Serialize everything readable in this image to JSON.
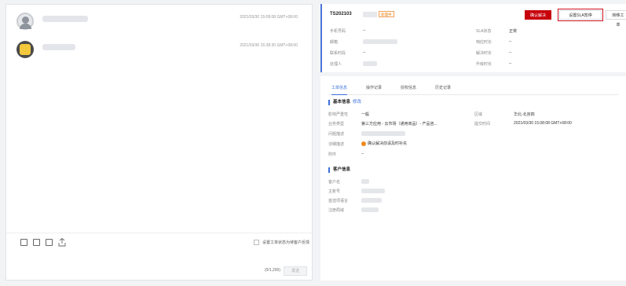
{
  "conversations": [
    {
      "time": "2021/03/30 15:08:08 GMT+08:00",
      "avatar": "user-avatar-icon"
    },
    {
      "time": "2021/03/30 15:38:30 GMT+08:00",
      "avatar": "bot-avatar-icon"
    }
  ],
  "composer": {
    "checkbox_label": "设置工单状态为待客户反馈",
    "counter": "(0/1,200)",
    "send_label": "发送"
  },
  "ticket": {
    "id": "TS202103",
    "status": "处理中",
    "buttons": {
      "confirm": "确认解决",
      "sla_pause": "设置SLA暂停",
      "transfer": "转移工单"
    },
    "fields_left": [
      {
        "key": "手机号码",
        "value": "--"
      },
      {
        "key": "邮箱",
        "value": ""
      },
      {
        "key": "联系时段",
        "value": "--"
      },
      {
        "key": "处理人",
        "value": ""
      }
    ],
    "fields_right": [
      {
        "key": "SLA状态",
        "value": "正常"
      },
      {
        "key": "响应时长",
        "value": "--"
      },
      {
        "key": "解决时长",
        "value": "--"
      },
      {
        "key": "升级时长",
        "value": "--"
      }
    ]
  },
  "tabs": [
    "工单信息",
    "操作记录",
    "授权信息",
    "历史记录"
  ],
  "basic": {
    "title": "基本信息",
    "edit": "修改",
    "rows": [
      {
        "key": "影响严重性",
        "value": "一般"
      },
      {
        "key": "业务类型",
        "value": "第三方应用 - 云市场（通用商品）- 产品咨..."
      },
      {
        "key": "问题描述",
        "value": ""
      },
      {
        "key": "详细描述",
        "value": "确认解决前请及时补充"
      },
      {
        "key": "附件",
        "value": "--"
      }
    ],
    "region_key": "区域",
    "region_value": "华北-北京四",
    "submit_key": "提交时间",
    "submit_value": "2021/03/30 15:08:08 GMT+08:00"
  },
  "customer": {
    "title": "客户信息",
    "rows": [
      {
        "key": "客户名"
      },
      {
        "key": "主账号"
      },
      {
        "key": "首选项语言"
      },
      {
        "key": "注册局域"
      }
    ]
  }
}
